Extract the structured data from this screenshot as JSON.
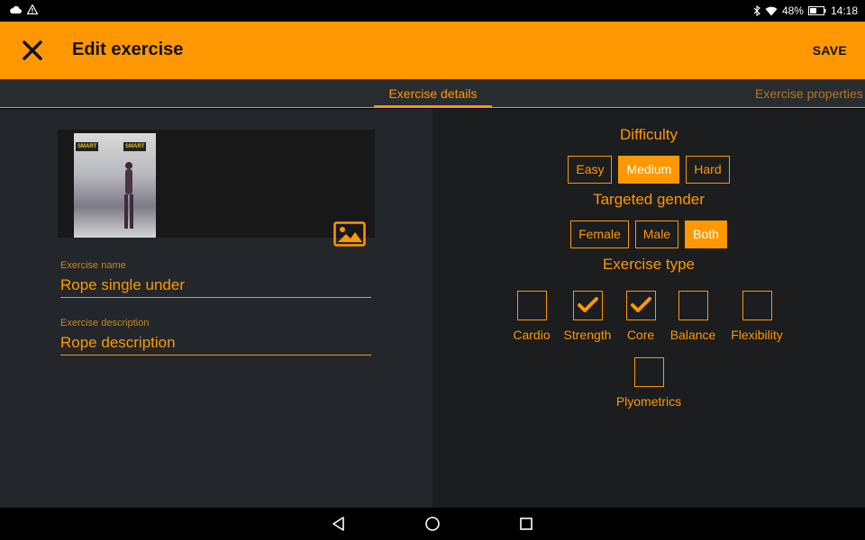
{
  "status_bar": {
    "left_icons": [
      "cloud-icon",
      "warning-icon"
    ],
    "battery": "48%",
    "time": "14:18",
    "right_icons": [
      "bluetooth-icon",
      "wifi-icon",
      "battery-icon"
    ]
  },
  "app_bar": {
    "title": "Edit exercise",
    "save_label": "SAVE",
    "close_icon": "close-icon",
    "color": "#ff9800"
  },
  "tabs": [
    {
      "label": "Exercise details",
      "active": true
    },
    {
      "label": "Exercise properties",
      "active": false
    }
  ],
  "details": {
    "image_signs": [
      "SMART",
      "SMART"
    ],
    "name_label": "Exercise name",
    "name_value": "Rope single under",
    "description_label": "Exercise description",
    "description_value": "Rope description"
  },
  "properties": {
    "difficulty_title": "Difficulty",
    "difficulty_options": [
      {
        "label": "Easy",
        "selected": false
      },
      {
        "label": "Medium",
        "selected": true
      },
      {
        "label": "Hard",
        "selected": false
      }
    ],
    "gender_title": "Targeted gender",
    "gender_options": [
      {
        "label": "Female",
        "selected": false
      },
      {
        "label": "Male",
        "selected": false
      },
      {
        "label": "Both",
        "selected": true
      }
    ],
    "type_title": "Exercise type",
    "type_options": [
      {
        "label": "Cardio",
        "checked": false
      },
      {
        "label": "Strength",
        "checked": true
      },
      {
        "label": "Core",
        "checked": true
      },
      {
        "label": "Balance",
        "checked": false
      },
      {
        "label": "Flexibility",
        "checked": false
      },
      {
        "label": "Plyometrics",
        "checked": false
      }
    ]
  },
  "nav_bar": {
    "buttons": [
      "back-icon",
      "home-icon",
      "recents-icon"
    ]
  },
  "colors": {
    "accent": "#ff9800",
    "panel_left": "#23262a",
    "panel_right": "#1c1d1f"
  }
}
